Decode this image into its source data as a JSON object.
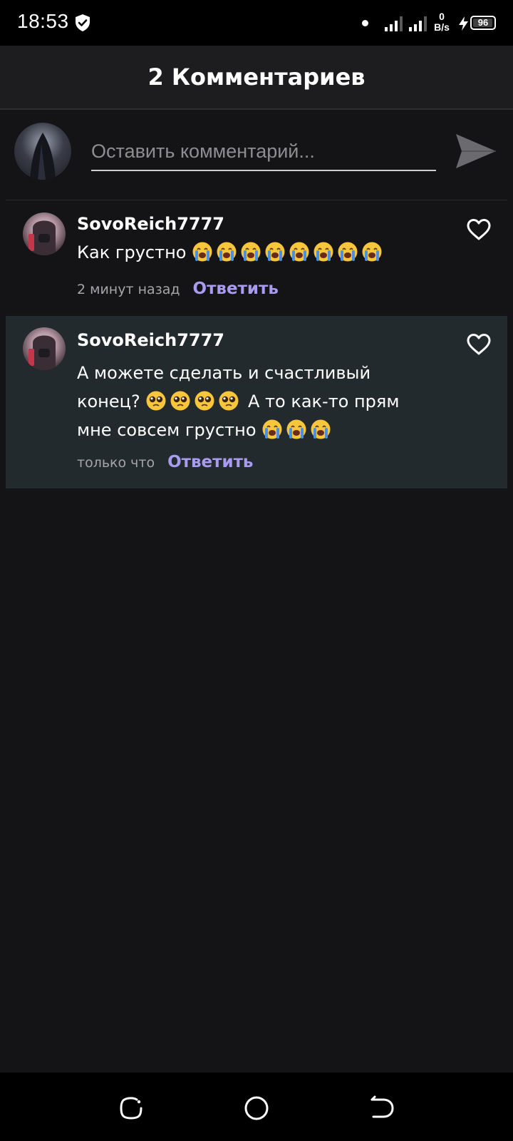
{
  "status_bar": {
    "time": "18:53",
    "net_speed_value": "0",
    "net_speed_unit": "B/s",
    "battery_level": "96"
  },
  "header": {
    "title": "2 Комментариев"
  },
  "composer": {
    "placeholder": "Оставить комментарий..."
  },
  "comments": [
    {
      "username": "SovoReich7777",
      "text": "Как грустно",
      "emojis": [
        "crying-face",
        "crying-face",
        "crying-face",
        "crying-face",
        "crying-face",
        "crying-face",
        "crying-face",
        "crying-face"
      ],
      "time": "2 минут назад",
      "reply_label": "Ответить"
    },
    {
      "username": "SovoReich7777",
      "text_line1": "А можете сделать и счастливый",
      "text_line2_start": "конец?",
      "emojis_mid": [
        "pleading-face",
        "pleading-face",
        "pleading-face",
        "pleading-face"
      ],
      "text_line2_end": "А то как-то прям",
      "text_line3": "мне совсем грустно",
      "emojis_end": [
        "crying-face",
        "crying-face",
        "crying-face"
      ],
      "time": "только что",
      "reply_label": "Ответить"
    }
  ],
  "icons": {
    "send": "send-icon",
    "like": "heart-outline-icon",
    "nav": [
      "recents-icon",
      "home-icon",
      "back-icon"
    ]
  },
  "colors": {
    "background": "#141416",
    "header_bg": "#1d1d1f",
    "highlight_comment_bg": "#222a2d",
    "reply_accent": "#a99cf0",
    "meta_text": "#a6a6aa"
  }
}
